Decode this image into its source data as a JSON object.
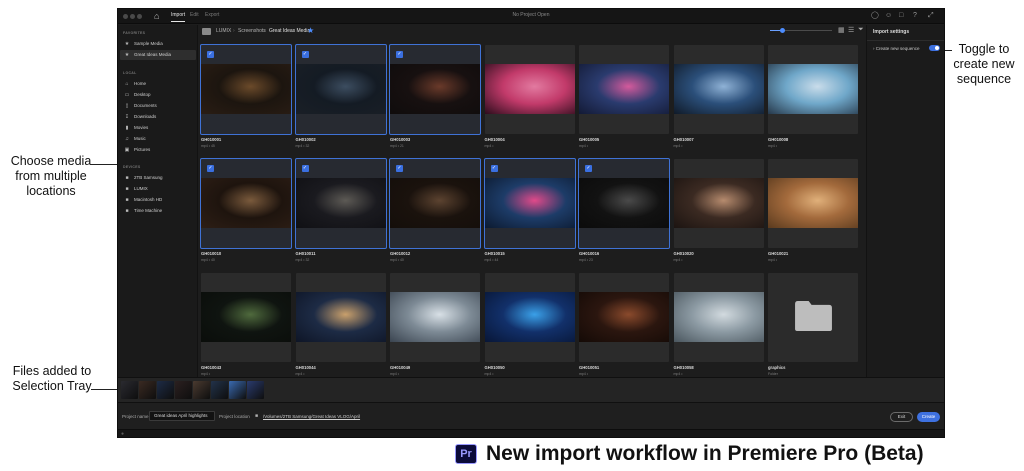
{
  "callouts": {
    "choose_media": "Choose media from multiple locations",
    "tray": "Files added to Selection Tray",
    "toggle": "Toggle to create new sequence"
  },
  "caption": {
    "logo": "Pr",
    "text": "New import workflow in Premiere Pro (Beta)"
  },
  "titlebar": {
    "tabs": [
      "Import",
      "Edit",
      "Export"
    ],
    "active_tab": "Import",
    "title": "No Project Open"
  },
  "sidebar": {
    "favorites_heading": "FAVORITES",
    "favorites": [
      {
        "label": "Sample Media",
        "icon": "star-icon"
      },
      {
        "label": "Great Ideas Media",
        "icon": "star-icon",
        "selected": true
      }
    ],
    "local_heading": "LOCAL",
    "local": [
      {
        "label": "Home",
        "icon": "home-icon"
      },
      {
        "label": "Desktop",
        "icon": "monitor-icon"
      },
      {
        "label": "Documents",
        "icon": "document-icon"
      },
      {
        "label": "Downloads",
        "icon": "download-icon"
      },
      {
        "label": "Movies",
        "icon": "movie-icon"
      },
      {
        "label": "Music",
        "icon": "music-icon"
      },
      {
        "label": "Pictures",
        "icon": "picture-icon"
      }
    ],
    "devices_heading": "DEVICES",
    "devices": [
      {
        "label": "2TB Samsung",
        "icon": "folder-icon"
      },
      {
        "label": "LUMIX",
        "icon": "folder-icon"
      },
      {
        "label": "Macintosh HD",
        "icon": "folder-icon"
      },
      {
        "label": "Time Machine",
        "icon": "folder-icon"
      }
    ]
  },
  "breadcrumb": [
    "LUMIX",
    "Screenshots",
    "Great Ideas Media"
  ],
  "zoom_level": 0.2,
  "media": [
    {
      "name": "GH010001",
      "meta": "mp4 • 45",
      "selected": true,
      "colors": [
        "#1c150f",
        "#6b4a2a",
        "#2a1d14"
      ]
    },
    {
      "name": "GH010002",
      "meta": "mp4 • 32",
      "selected": true,
      "colors": [
        "#141b24",
        "#3c4d60",
        "#1a1f26"
      ]
    },
    {
      "name": "GH010003",
      "meta": "mp4 • 21",
      "selected": true,
      "colors": [
        "#171010",
        "#6a3a2a",
        "#0f0c0c"
      ]
    },
    {
      "name": "GH010004",
      "meta": "mp4 •",
      "selected": false,
      "colors": [
        "#c23a6a",
        "#e27aa0",
        "#2c0d1c"
      ]
    },
    {
      "name": "GH010005",
      "meta": "mp4 •",
      "selected": false,
      "colors": [
        "#2a3b6e",
        "#d35a9c",
        "#131a35"
      ]
    },
    {
      "name": "GH010007",
      "meta": "mp4 •",
      "selected": false,
      "colors": [
        "#2b4f7a",
        "#8fb2d6",
        "#101a28"
      ]
    },
    {
      "name": "GH010008",
      "meta": "mp4 •",
      "selected": false,
      "colors": [
        "#6fa7c9",
        "#c9dcea",
        "#26384a"
      ]
    },
    {
      "name": "GH010010",
      "meta": "mp4 • 40",
      "selected": true,
      "colors": [
        "#1e140e",
        "#7a5a3c",
        "#2d1e15"
      ]
    },
    {
      "name": "GH010011",
      "meta": "mp4 • 32",
      "selected": true,
      "colors": [
        "#1a1a1f",
        "#5d5a55",
        "#101014"
      ]
    },
    {
      "name": "GH010012",
      "meta": "mp4 • 40",
      "selected": true,
      "colors": [
        "#1a120d",
        "#5c4330",
        "#140e0a"
      ]
    },
    {
      "name": "GH010015",
      "meta": "mp4 • 44",
      "selected": true,
      "colors": [
        "#1d3c68",
        "#e04a8a",
        "#0c1a30"
      ]
    },
    {
      "name": "GH010016",
      "meta": "mp4 • 23",
      "selected": true,
      "colors": [
        "#121212",
        "#4a4a4a",
        "#0b0b0b"
      ]
    },
    {
      "name": "GH010020",
      "meta": "mp4 •",
      "selected": false,
      "colors": [
        "#3b2a22",
        "#b68b6e",
        "#1c1411"
      ]
    },
    {
      "name": "GH010021",
      "meta": "mp4 •",
      "selected": false,
      "colors": [
        "#a36a3c",
        "#e0b07a",
        "#5a3a1e"
      ]
    },
    {
      "name": "GH010043",
      "meta": "mp4 •",
      "selected": false,
      "colors": [
        "#0f1410",
        "#4f6a3d",
        "#0a0d0a"
      ]
    },
    {
      "name": "GH010044",
      "meta": "mp4 •",
      "selected": false,
      "colors": [
        "#1d2b45",
        "#c9a06c",
        "#0e1526"
      ]
    },
    {
      "name": "GH010049",
      "meta": "mp4 •",
      "selected": false,
      "colors": [
        "#7d8a95",
        "#d8e0e6",
        "#3a4450"
      ]
    },
    {
      "name": "GH010050",
      "meta": "mp4 •",
      "selected": false,
      "colors": [
        "#12306a",
        "#3aa0e8",
        "#081636"
      ]
    },
    {
      "name": "GH010051",
      "meta": "mp4 •",
      "selected": false,
      "colors": [
        "#2b160f",
        "#8a4a2c",
        "#140a06"
      ]
    },
    {
      "name": "GH010058",
      "meta": "mp4 •",
      "selected": false,
      "colors": [
        "#8c9aa3",
        "#d2dadf",
        "#4a565e"
      ]
    },
    {
      "name": "graphics",
      "meta": "Folder",
      "selected": false,
      "is_folder": true
    }
  ],
  "tray_colors": [
    "#2a2a30",
    "#3a2a22",
    "#1d2b45",
    "#2b2020",
    "#4a3a30",
    "#22324a",
    "#3a6ab0",
    "#2a3b6e"
  ],
  "bottom": {
    "project_name_label": "Project name",
    "project_name_value": "Great ideas April highlights",
    "project_location_label": "Project location",
    "project_location_value": "/Volumes/2TB Samsung/Great Ideas VLOG/April",
    "exit_label": "Exit",
    "create_label": "Create"
  },
  "settings": {
    "title": "Import settings",
    "create_sequence_label": "Create new sequence",
    "create_sequence_on": true
  },
  "colors": {
    "accent": "#3e71e0",
    "callout_dot": "#e8201b"
  }
}
